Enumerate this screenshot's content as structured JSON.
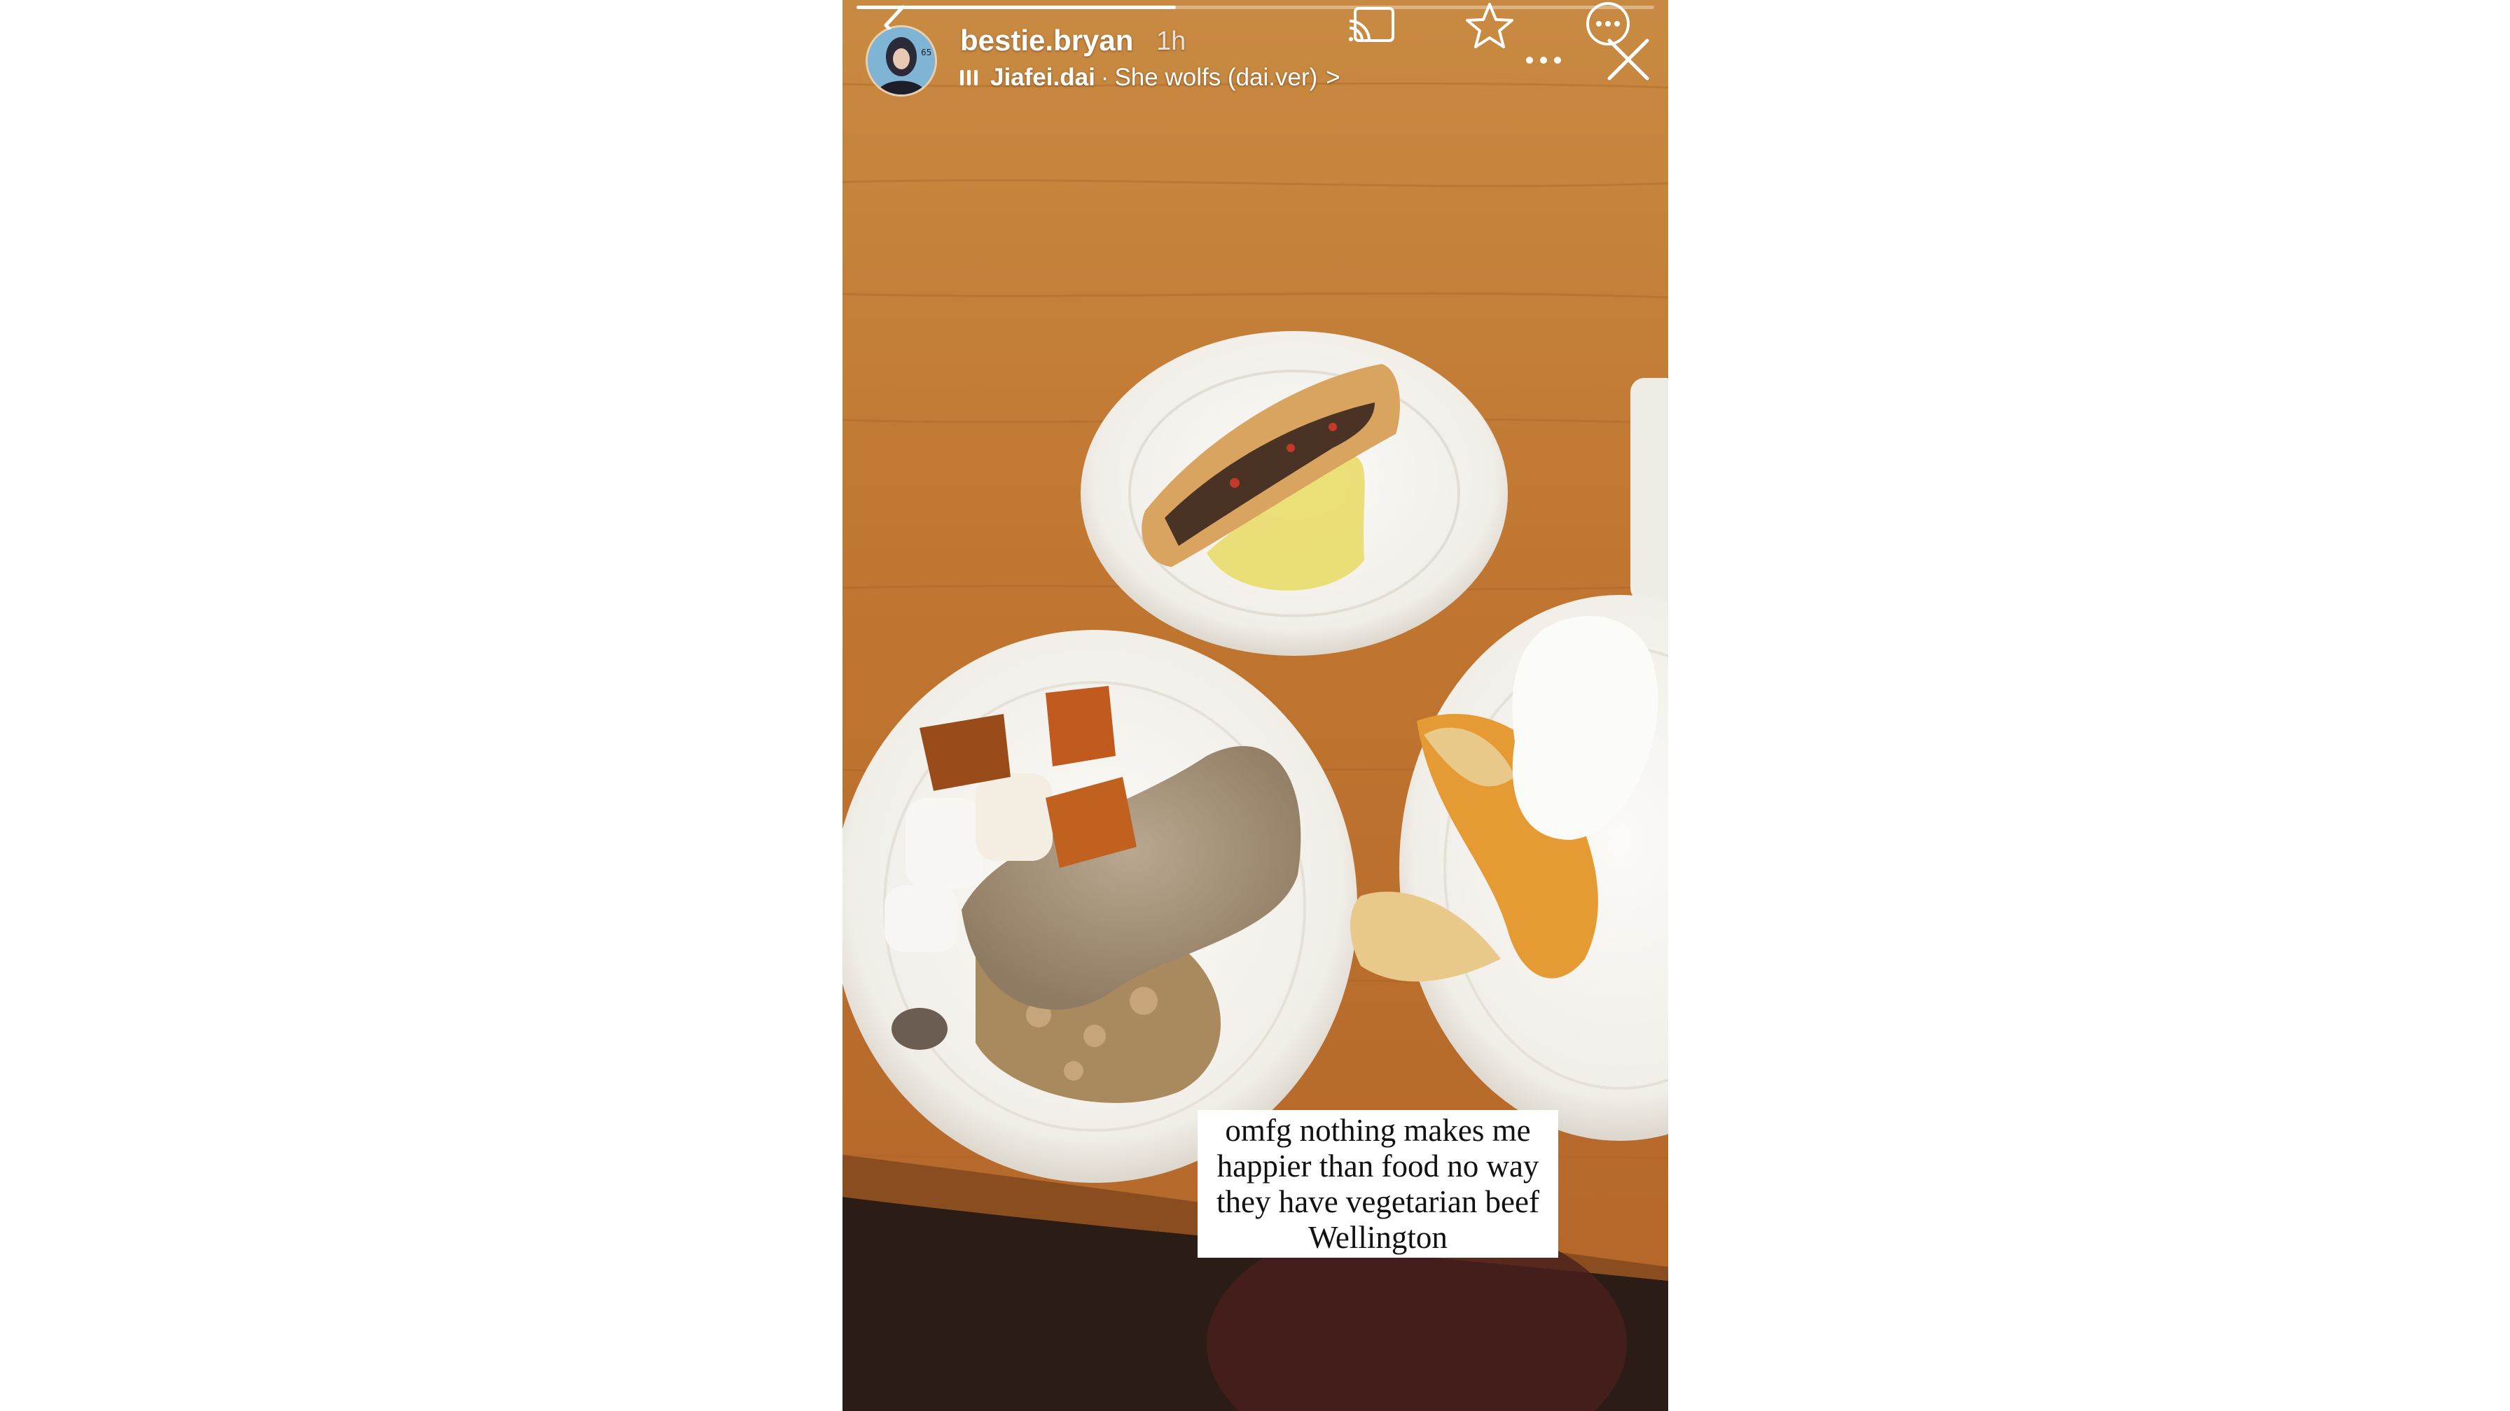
{
  "story": {
    "username": "bestie.bryan",
    "time_ago": "1h",
    "music": {
      "artist": "Jiafei.dai",
      "separator": "·",
      "track": "She wolfs (dai.ver)",
      "chevron": ">"
    },
    "caption": "omfg nothing makes me happier than food no way they have vegetarian beef Wellington",
    "progress": 0.4
  },
  "icons": {
    "back": "chevron-left-icon",
    "cast": "cast-icon",
    "favorite": "star-icon",
    "more": "more-dots-icon",
    "close": "close-x-icon",
    "music": "music-bars-icon"
  },
  "colors": {
    "table_wood": "#c47d33",
    "plate": "#f5f3ef",
    "caption_bg": "#ffffff",
    "text": "#ffffff"
  }
}
